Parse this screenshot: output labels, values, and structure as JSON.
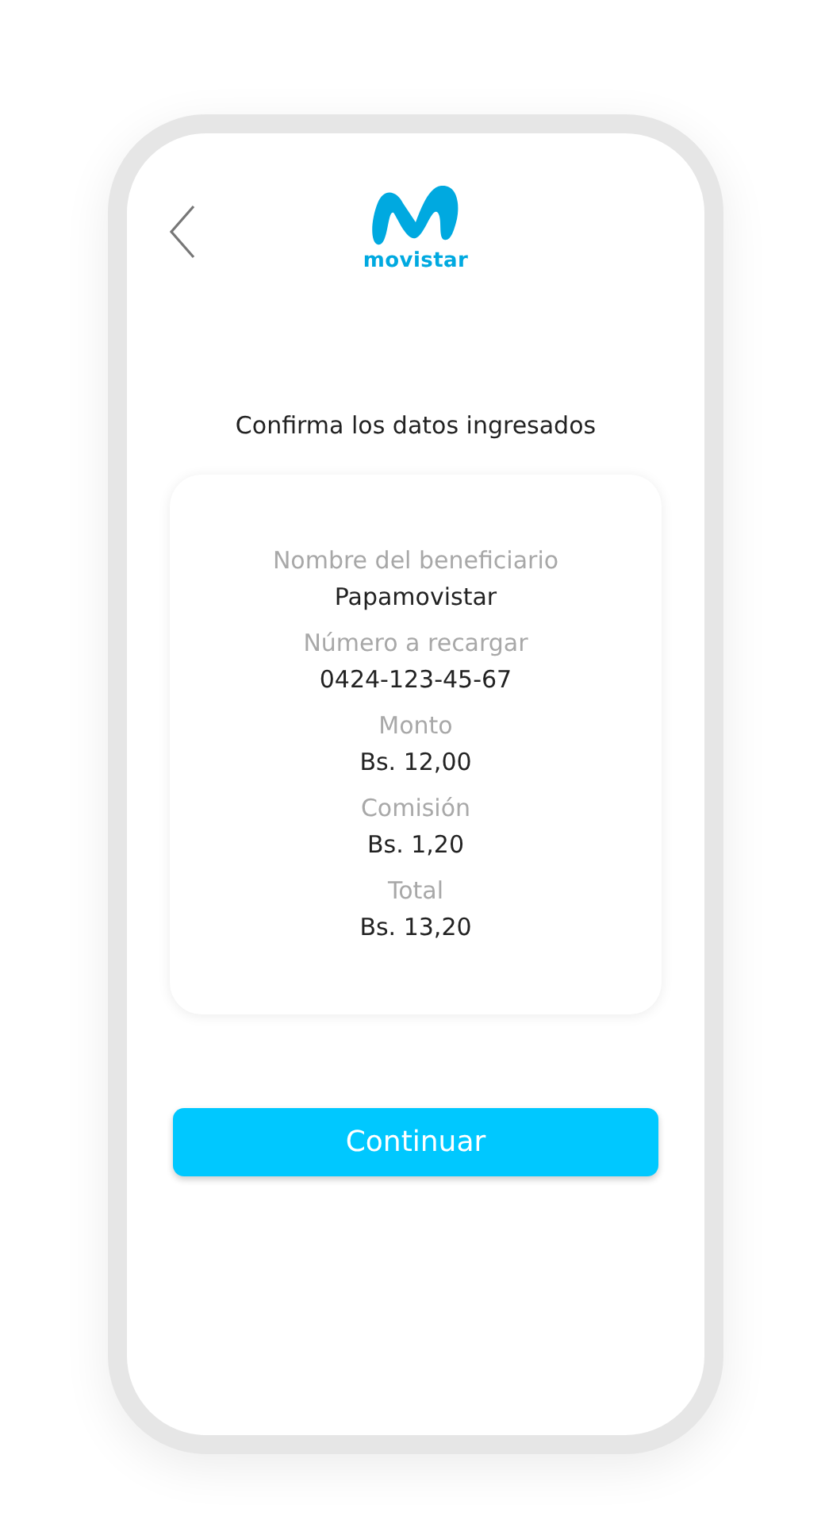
{
  "header": {
    "logo": {
      "wordmark": "movistar"
    }
  },
  "title": "Confirma los datos ingresados",
  "details": [
    {
      "label": "Nombre del beneficiario",
      "value": "Papamovistar"
    },
    {
      "label": "Número a recargar",
      "value": "0424-123-45-67"
    },
    {
      "label": "Monto",
      "value": "Bs. 12,00"
    },
    {
      "label": "Comisión",
      "value": "Bs. 1,20"
    },
    {
      "label": "Total",
      "value": "Bs. 13,20"
    }
  ],
  "button": {
    "label": "Continuar"
  }
}
